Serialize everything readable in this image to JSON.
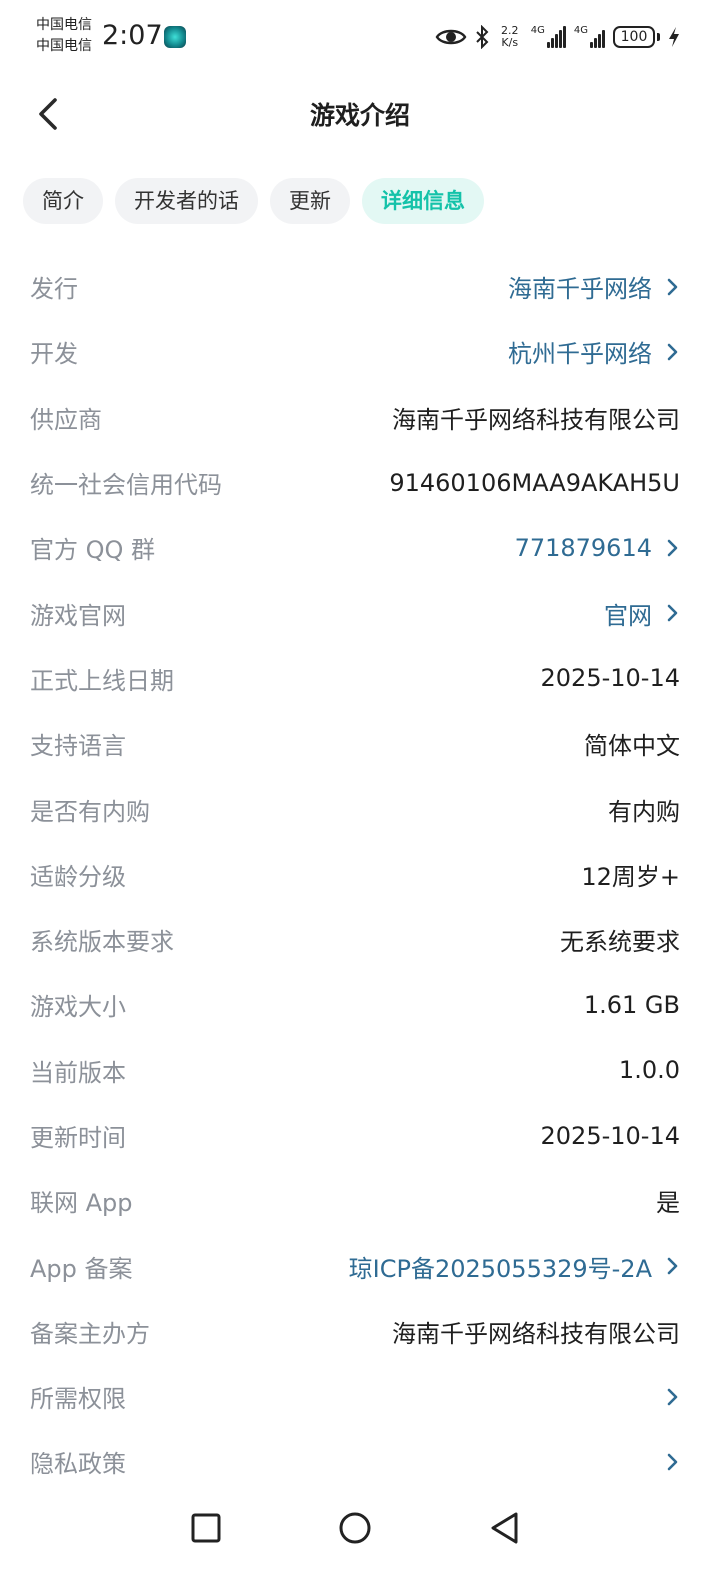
{
  "status_bar": {
    "carrier_1": "中国电信",
    "carrier_2": "中国电信",
    "time": "2:07",
    "net_speed_value": "2.2",
    "net_speed_unit": "K/s",
    "signal_1_label": "4G",
    "signal_2_label": "4G",
    "battery": "100"
  },
  "header": {
    "title": "游戏介绍"
  },
  "tabs": [
    {
      "label": "简介",
      "active": false
    },
    {
      "label": "开发者的话",
      "active": false
    },
    {
      "label": "更新",
      "active": false
    },
    {
      "label": "详细信息",
      "active": true
    }
  ],
  "info": [
    {
      "label": "发行",
      "value": "海南千乎网络",
      "link": true
    },
    {
      "label": "开发",
      "value": "杭州千乎网络",
      "link": true
    },
    {
      "label": "供应商",
      "value": "海南千乎网络科技有限公司",
      "link": false
    },
    {
      "label": "统一社会信用代码",
      "value": "91460106MAA9AKAH5U",
      "link": false
    },
    {
      "label": "官方 QQ 群",
      "value": "771879614",
      "link": true
    },
    {
      "label": "游戏官网",
      "value": "官网",
      "link": true
    },
    {
      "label": "正式上线日期",
      "value": "2025-10-14",
      "link": false
    },
    {
      "label": "支持语言",
      "value": "简体中文",
      "link": false
    },
    {
      "label": "是否有内购",
      "value": "有内购",
      "link": false
    },
    {
      "label": "适龄分级",
      "value": "12周岁+",
      "link": false
    },
    {
      "label": "系统版本要求",
      "value": "无系统要求",
      "link": false
    },
    {
      "label": "游戏大小",
      "value": "1.61 GB",
      "link": false
    },
    {
      "label": "当前版本",
      "value": "1.0.0",
      "link": false
    },
    {
      "label": "更新时间",
      "value": "2025-10-14",
      "link": false
    },
    {
      "label": "联网 App",
      "value": "是",
      "link": false
    },
    {
      "label": "App 备案",
      "value": "琼ICP备2025055329号-2A",
      "link": true
    },
    {
      "label": "备案主办方",
      "value": "海南千乎网络科技有限公司",
      "link": false
    },
    {
      "label": "所需权限",
      "value": "",
      "link": true
    },
    {
      "label": "隐私政策",
      "value": "",
      "link": true
    }
  ],
  "colors": {
    "accent": "#14c2a9",
    "link": "#2f6b93",
    "label": "#8c9199"
  },
  "icons": {
    "back": "back-arrow-icon",
    "chevron": "chevron-right-icon",
    "nav_recent": "square-icon",
    "nav_home": "circle-icon",
    "nav_back": "triangle-back-icon"
  }
}
